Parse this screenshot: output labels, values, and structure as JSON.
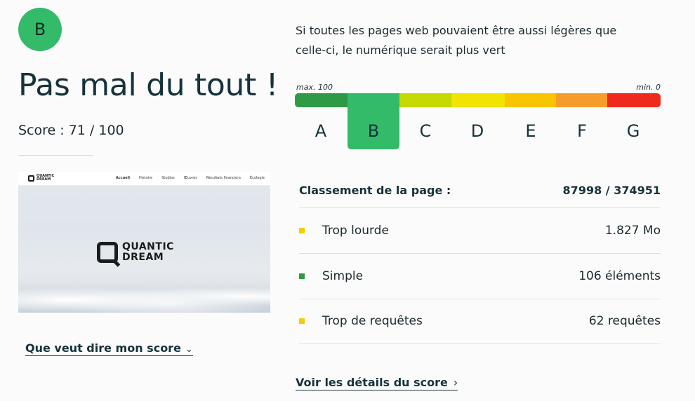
{
  "grade": {
    "letter": "B",
    "color": "#33bb6a"
  },
  "headline": "Pas mal du tout !",
  "score_text": "Score : 71 / 100",
  "thumbnail": {
    "brand_small": [
      "QUANTIC",
      "DREAM"
    ],
    "menu": [
      "Accueil",
      "Histoire",
      "Studios",
      "Œuvres",
      "Résultats financiers",
      "Écologie"
    ],
    "brand_large": [
      "QUANTIC",
      "DREAM"
    ]
  },
  "meaning_link": {
    "label": "Que veut dire mon score",
    "icon": "chevron-down-icon"
  },
  "intro": "Si toutes les pages web pouvaient être aussi légères que celle-ci, le numérique serait plus vert",
  "scale": {
    "max_label": "max. 100",
    "min_label": "min. 0",
    "grades": [
      {
        "letter": "A",
        "color": "#2f9a46"
      },
      {
        "letter": "B",
        "color": "#33bb6a"
      },
      {
        "letter": "C",
        "color": "#c5d800"
      },
      {
        "letter": "D",
        "color": "#f0e400"
      },
      {
        "letter": "E",
        "color": "#f8c500"
      },
      {
        "letter": "F",
        "color": "#f59d2a"
      },
      {
        "letter": "G",
        "color": "#ee2a1c"
      }
    ],
    "selected": "B"
  },
  "ranking": {
    "label": "Classement de la page :",
    "value": "87998 / 374951"
  },
  "metrics": [
    {
      "label": "Trop lourde",
      "value": "1.827 Mo",
      "color": "#f5cc00"
    },
    {
      "label": "Simple",
      "value": "106 éléments",
      "color": "#2f9a46"
    },
    {
      "label": "Trop de requêtes",
      "value": "62 requêtes",
      "color": "#f5cc00"
    }
  ],
  "details_link": {
    "label": "Voir les détails du score",
    "icon": "chevron-right-icon"
  }
}
